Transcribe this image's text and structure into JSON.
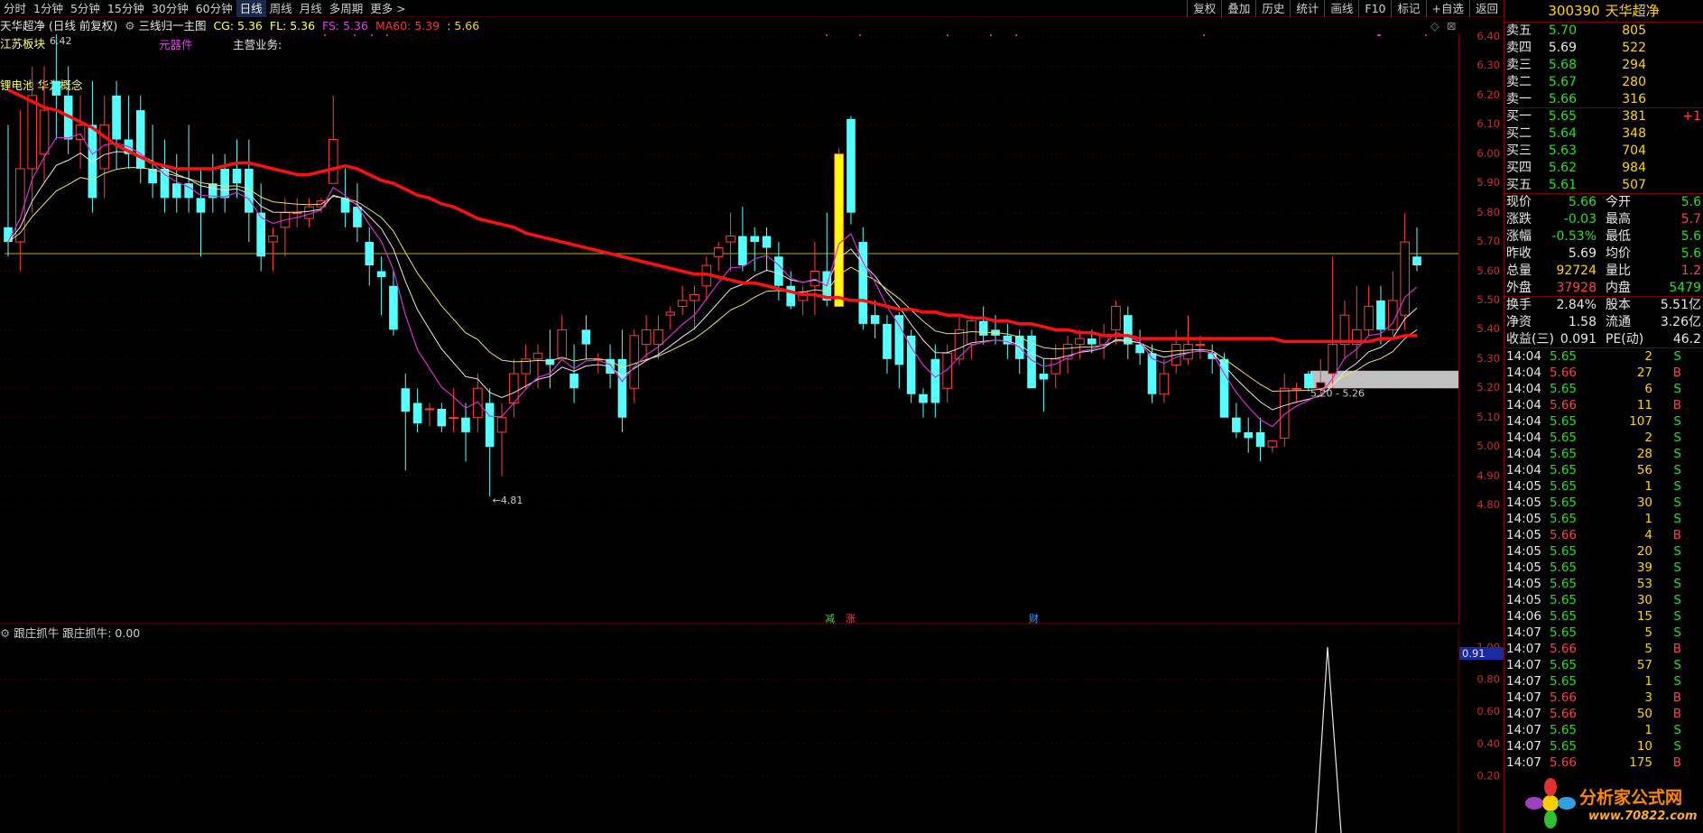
{
  "toolbar": {
    "periods": [
      "分时",
      "1分钟",
      "5分钟",
      "15分钟",
      "30分钟",
      "60分钟",
      "日线",
      "周线",
      "月线",
      "多周期",
      "更多 >"
    ],
    "active": "日线",
    "right": [
      "复权",
      "叠加",
      "历史",
      "统计",
      "画线",
      "F10",
      "标记",
      "+自选",
      "返回"
    ]
  },
  "info": {
    "stock_label": "天华超净",
    "mode": "(日线 前复权)",
    "indicator": "三线归一主图",
    "cg_label": "CG: 5.36",
    "fl_label": "FL: 5.36",
    "fs_label": "FS: 5.36",
    "ma60_label": "MA60: 5.39",
    "extra": ": 5.66",
    "sector": "江苏板块",
    "sector_price": "6.42",
    "component": "元器件",
    "business": "主营业务:",
    "concept": "锂电池 华为概念",
    "low_mark": "4.81",
    "range_mark": "5.20 - 5.26",
    "event_a": "减",
    "event_b": "涨",
    "event_c": "财"
  },
  "price_axis": [
    "6.40",
    "6.30",
    "6.20",
    "6.10",
    "6.00",
    "5.90",
    "5.80",
    "5.70",
    "5.60",
    "5.50",
    "5.40",
    "5.30",
    "5.20",
    "5.10",
    "5.00",
    "4.90",
    "4.80"
  ],
  "sub": {
    "title": "跟庄抓牛",
    "value_label": "跟庄抓牛: 0.00",
    "cursor_value": "0.91",
    "axis": [
      "1.00",
      "0.80",
      "0.60",
      "0.40",
      "0.20"
    ]
  },
  "chart_data": {
    "type": "candlestick",
    "ylim": [
      4.75,
      6.45
    ],
    "ohlc": [
      [
        5.75,
        6.1,
        5.65,
        5.7
      ],
      [
        5.7,
        6.15,
        5.6,
        5.95
      ],
      [
        5.95,
        6.3,
        5.8,
        6.2
      ],
      [
        6.0,
        6.3,
        5.9,
        6.15
      ],
      [
        6.25,
        6.42,
        6.05,
        6.2
      ],
      [
        6.2,
        6.3,
        6.0,
        6.05
      ],
      [
        6.05,
        6.2,
        5.95,
        6.1
      ],
      [
        6.1,
        6.25,
        5.8,
        5.85
      ],
      [
        5.95,
        6.2,
        5.85,
        6.1
      ],
      [
        6.2,
        6.25,
        5.95,
        6.05
      ],
      [
        6.05,
        6.2,
        5.95,
        6.0
      ],
      [
        6.15,
        6.2,
        5.9,
        5.95
      ],
      [
        5.95,
        6.1,
        5.85,
        5.9
      ],
      [
        5.95,
        6.05,
        5.8,
        5.85
      ],
      [
        5.9,
        6.0,
        5.8,
        5.85
      ],
      [
        5.9,
        6.1,
        5.8,
        5.85
      ],
      [
        5.85,
        5.95,
        5.65,
        5.8
      ],
      [
        5.9,
        6.0,
        5.8,
        5.85
      ],
      [
        5.95,
        6.0,
        5.8,
        5.85
      ],
      [
        5.95,
        6.05,
        5.85,
        5.9
      ],
      [
        5.95,
        6.05,
        5.7,
        5.8
      ],
      [
        5.8,
        5.9,
        5.6,
        5.65
      ],
      [
        5.7,
        5.75,
        5.6,
        5.72
      ],
      [
        5.75,
        5.85,
        5.65,
        5.8
      ],
      [
        5.8,
        5.85,
        5.75,
        5.8
      ],
      [
        5.78,
        5.85,
        5.75,
        5.82
      ],
      [
        5.82,
        5.85,
        5.8,
        5.84
      ],
      [
        5.9,
        6.2,
        5.9,
        6.05
      ],
      [
        5.85,
        5.95,
        5.75,
        5.8
      ],
      [
        5.82,
        5.9,
        5.7,
        5.75
      ],
      [
        5.7,
        5.75,
        5.55,
        5.62
      ],
      [
        5.6,
        5.65,
        5.45,
        5.58
      ],
      [
        5.55,
        5.6,
        5.38,
        5.4
      ],
      [
        5.2,
        5.25,
        4.92,
        5.12
      ],
      [
        5.15,
        5.2,
        5.05,
        5.08
      ],
      [
        5.13,
        5.15,
        5.07,
        5.13
      ],
      [
        5.13,
        5.15,
        5.05,
        5.07
      ],
      [
        5.1,
        5.2,
        5.05,
        5.1
      ],
      [
        5.1,
        5.15,
        4.95,
        5.05
      ],
      [
        5.1,
        5.25,
        5.05,
        5.2
      ],
      [
        5.15,
        5.2,
        4.83,
        5.0
      ],
      [
        5.05,
        5.15,
        4.9,
        5.1
      ],
      [
        5.15,
        5.3,
        5.1,
        5.25
      ],
      [
        5.25,
        5.35,
        5.2,
        5.3
      ],
      [
        5.3,
        5.35,
        5.2,
        5.32
      ],
      [
        5.3,
        5.4,
        5.2,
        5.28
      ],
      [
        5.3,
        5.45,
        5.3,
        5.4
      ],
      [
        5.25,
        5.35,
        5.15,
        5.2
      ],
      [
        5.4,
        5.45,
        5.3,
        5.35
      ],
      [
        5.3,
        5.32,
        5.25,
        5.3
      ],
      [
        5.3,
        5.35,
        5.2,
        5.25
      ],
      [
        5.3,
        5.4,
        5.05,
        5.1
      ],
      [
        5.2,
        5.4,
        5.15,
        5.38
      ],
      [
        5.35,
        5.45,
        5.3,
        5.4
      ],
      [
        5.35,
        5.45,
        5.3,
        5.4
      ],
      [
        5.45,
        5.48,
        5.4,
        5.46
      ],
      [
        5.48,
        5.55,
        5.45,
        5.5
      ],
      [
        5.5,
        5.55,
        5.4,
        5.52
      ],
      [
        5.55,
        5.65,
        5.5,
        5.62
      ],
      [
        5.65,
        5.7,
        5.6,
        5.68
      ],
      [
        5.7,
        5.8,
        5.6,
        5.72
      ],
      [
        5.72,
        5.82,
        5.6,
        5.62
      ],
      [
        5.72,
        5.75,
        5.6,
        5.7
      ],
      [
        5.72,
        5.75,
        5.6,
        5.68
      ],
      [
        5.65,
        5.7,
        5.5,
        5.55
      ],
      [
        5.55,
        5.6,
        5.47,
        5.48
      ],
      [
        5.5,
        5.55,
        5.45,
        5.53
      ],
      [
        5.55,
        5.7,
        5.45,
        5.6
      ],
      [
        5.6,
        5.8,
        5.48,
        5.5
      ],
      [
        5.48,
        6.02,
        5.48,
        6.0
      ],
      [
        6.12,
        6.13,
        5.76,
        5.8
      ],
      [
        5.7,
        5.75,
        5.4,
        5.42
      ],
      [
        5.45,
        5.5,
        5.37,
        5.42
      ],
      [
        5.42,
        5.45,
        5.25,
        5.3
      ],
      [
        5.45,
        5.46,
        5.2,
        5.28
      ],
      [
        5.38,
        5.4,
        5.15,
        5.18
      ],
      [
        5.18,
        5.2,
        5.1,
        5.15
      ],
      [
        5.3,
        5.35,
        5.1,
        5.15
      ],
      [
        5.2,
        5.35,
        5.15,
        5.32
      ],
      [
        5.3,
        5.45,
        5.28,
        5.4
      ],
      [
        5.35,
        5.45,
        5.3,
        5.43
      ],
      [
        5.43,
        5.48,
        5.35,
        5.38
      ],
      [
        5.4,
        5.45,
        5.35,
        5.38
      ],
      [
        5.38,
        5.42,
        5.3,
        5.35
      ],
      [
        5.38,
        5.4,
        5.25,
        5.3
      ],
      [
        5.38,
        5.4,
        5.2,
        5.2
      ],
      [
        5.25,
        5.3,
        5.12,
        5.23
      ],
      [
        5.25,
        5.35,
        5.2,
        5.3
      ],
      [
        5.3,
        5.38,
        5.25,
        5.35
      ],
      [
        5.35,
        5.4,
        5.3,
        5.37
      ],
      [
        5.37,
        5.4,
        5.32,
        5.35
      ],
      [
        5.35,
        5.42,
        5.3,
        5.38
      ],
      [
        5.4,
        5.5,
        5.35,
        5.48
      ],
      [
        5.45,
        5.48,
        5.3,
        5.35
      ],
      [
        5.35,
        5.4,
        5.28,
        5.32
      ],
      [
        5.32,
        5.35,
        5.15,
        5.18
      ],
      [
        5.18,
        5.3,
        5.15,
        5.25
      ],
      [
        5.28,
        5.4,
        5.25,
        5.35
      ],
      [
        5.3,
        5.45,
        5.28,
        5.35
      ],
      [
        5.35,
        5.38,
        5.3,
        5.35
      ],
      [
        5.32,
        5.35,
        5.25,
        5.3
      ],
      [
        5.3,
        5.32,
        5.1,
        5.1
      ],
      [
        5.1,
        5.15,
        5.03,
        5.05
      ],
      [
        5.05,
        5.1,
        4.98,
        5.03
      ],
      [
        5.05,
        5.1,
        4.95,
        5.0
      ],
      [
        5.0,
        5.02,
        4.98,
        5.02
      ],
      [
        5.03,
        5.25,
        5.0,
        5.2
      ],
      [
        5.2,
        5.22,
        5.15,
        5.2
      ],
      [
        5.25,
        5.26,
        5.19,
        5.2
      ],
      [
        5.2,
        5.3,
        5.18,
        5.22
      ],
      [
        5.25,
        5.65,
        5.2,
        5.35
      ],
      [
        5.35,
        5.5,
        5.3,
        5.45
      ],
      [
        5.35,
        5.55,
        5.3,
        5.4
      ],
      [
        5.4,
        5.55,
        5.38,
        5.48
      ],
      [
        5.5,
        5.55,
        5.35,
        5.4
      ],
      [
        5.4,
        5.6,
        5.38,
        5.5
      ],
      [
        5.45,
        5.8,
        5.4,
        5.7
      ],
      [
        5.65,
        5.75,
        5.6,
        5.62
      ]
    ],
    "ma60": [
      6.22,
      6.2,
      6.18,
      6.16,
      6.15,
      6.13,
      6.11,
      6.09,
      6.06,
      6.03,
      6.01,
      5.99,
      5.97,
      5.96,
      5.95,
      5.95,
      5.95,
      5.95,
      5.96,
      5.97,
      5.97,
      5.96,
      5.95,
      5.94,
      5.93,
      5.93,
      5.94,
      5.95,
      5.96,
      5.95,
      5.93,
      5.91,
      5.9,
      5.88,
      5.86,
      5.85,
      5.83,
      5.82,
      5.8,
      5.78,
      5.77,
      5.76,
      5.75,
      5.73,
      5.72,
      5.71,
      5.7,
      5.69,
      5.68,
      5.67,
      5.66,
      5.65,
      5.64,
      5.63,
      5.62,
      5.61,
      5.6,
      5.59,
      5.59,
      5.58,
      5.57,
      5.56,
      5.56,
      5.55,
      5.54,
      5.53,
      5.52,
      5.52,
      5.51,
      5.51,
      5.5,
      5.5,
      5.49,
      5.48,
      5.47,
      5.47,
      5.46,
      5.46,
      5.45,
      5.45,
      5.44,
      5.44,
      5.43,
      5.43,
      5.42,
      5.42,
      5.41,
      5.4,
      5.4,
      5.39,
      5.39,
      5.38,
      5.38,
      5.38,
      5.37,
      5.37,
      5.37,
      5.37,
      5.37,
      5.37,
      5.37,
      5.37,
      5.37,
      5.37,
      5.37,
      5.37,
      5.36,
      5.36,
      5.36,
      5.36,
      5.36,
      5.36,
      5.36,
      5.36,
      5.37,
      5.37,
      5.38,
      5.38
    ],
    "kline_colors": {
      "up": "#ff3c3c",
      "down": "#54ffff",
      "ma60": "#ff1010",
      "cg": "#e8e8e8",
      "fl": "#e8e070",
      "fs": "#d030d0"
    }
  },
  "quote": {
    "code": "300390",
    "name": "天华超净",
    "asks": [
      {
        "label": "卖五",
        "price": "5.70",
        "vol": "805"
      },
      {
        "label": "卖四",
        "price": "5.69",
        "vol": "522"
      },
      {
        "label": "卖三",
        "price": "5.68",
        "vol": "294"
      },
      {
        "label": "卖二",
        "price": "5.67",
        "vol": "280"
      },
      {
        "label": "卖一",
        "price": "5.66",
        "vol": "316"
      }
    ],
    "bids": [
      {
        "label": "买一",
        "price": "5.65",
        "vol": "381",
        "extra": "+1"
      },
      {
        "label": "买二",
        "price": "5.64",
        "vol": "348"
      },
      {
        "label": "买三",
        "price": "5.63",
        "vol": "704"
      },
      {
        "label": "买四",
        "price": "5.62",
        "vol": "984"
      },
      {
        "label": "买五",
        "price": "5.61",
        "vol": "507"
      }
    ],
    "stats": [
      {
        "l1": "现价",
        "v1": "5.66",
        "c1": "g",
        "l2": "今开",
        "v2": "5.6",
        "c2": "g"
      },
      {
        "l1": "涨跌",
        "v1": "-0.03",
        "c1": "g",
        "l2": "最高",
        "v2": "5.7",
        "c2": "r"
      },
      {
        "l1": "涨幅",
        "v1": "-0.53%",
        "c1": "g",
        "l2": "最低",
        "v2": "5.6",
        "c2": "g"
      },
      {
        "l1": "昨收",
        "v1": "5.69",
        "c1": "w",
        "l2": "均价",
        "v2": "5.6",
        "c2": "g"
      },
      {
        "l1": "总量",
        "v1": "92724",
        "c1": "y",
        "l2": "量比",
        "v2": "1.2",
        "c2": "r"
      },
      {
        "l1": "外盘",
        "v1": "37928",
        "c1": "r",
        "l2": "内盘",
        "v2": "5479",
        "c2": "g"
      },
      {
        "l1": "换手",
        "v1": "2.84%",
        "c1": "w",
        "l2": "股本",
        "v2": "5.51亿",
        "c2": "w"
      },
      {
        "l1": "净资",
        "v1": "1.58",
        "c1": "w",
        "l2": "流通",
        "v2": "3.26亿",
        "c2": "w"
      },
      {
        "l1": "收益(三)",
        "v1": "0.091",
        "c1": "w",
        "l2": "PE(动)",
        "v2": "46.2",
        "c2": "w"
      }
    ],
    "ticks": [
      {
        "t": "14:04",
        "p": "5.65",
        "v": "2",
        "s": "S"
      },
      {
        "t": "14:04",
        "p": "5.66",
        "v": "27",
        "s": "B"
      },
      {
        "t": "14:04",
        "p": "5.65",
        "v": "6",
        "s": "S"
      },
      {
        "t": "14:04",
        "p": "5.66",
        "v": "11",
        "s": "B"
      },
      {
        "t": "14:04",
        "p": "5.65",
        "v": "107",
        "s": "S"
      },
      {
        "t": "14:04",
        "p": "5.65",
        "v": "2",
        "s": "S"
      },
      {
        "t": "14:04",
        "p": "5.65",
        "v": "28",
        "s": "S"
      },
      {
        "t": "14:04",
        "p": "5.65",
        "v": "56",
        "s": "S"
      },
      {
        "t": "14:05",
        "p": "5.65",
        "v": "1",
        "s": "S"
      },
      {
        "t": "14:05",
        "p": "5.65",
        "v": "30",
        "s": "S"
      },
      {
        "t": "14:05",
        "p": "5.65",
        "v": "1",
        "s": "S"
      },
      {
        "t": "14:05",
        "p": "5.66",
        "v": "4",
        "s": "B"
      },
      {
        "t": "14:05",
        "p": "5.65",
        "v": "20",
        "s": "S"
      },
      {
        "t": "14:05",
        "p": "5.65",
        "v": "39",
        "s": "S"
      },
      {
        "t": "14:05",
        "p": "5.65",
        "v": "53",
        "s": "S"
      },
      {
        "t": "14:05",
        "p": "5.65",
        "v": "30",
        "s": "S"
      },
      {
        "t": "14:06",
        "p": "5.65",
        "v": "15",
        "s": "S"
      },
      {
        "t": "14:07",
        "p": "5.65",
        "v": "5",
        "s": "S"
      },
      {
        "t": "14:07",
        "p": "5.66",
        "v": "5",
        "s": "B"
      },
      {
        "t": "14:07",
        "p": "5.65",
        "v": "57",
        "s": "S"
      },
      {
        "t": "14:07",
        "p": "5.65",
        "v": "1",
        "s": "S"
      },
      {
        "t": "14:07",
        "p": "5.66",
        "v": "3",
        "s": "B"
      },
      {
        "t": "14:07",
        "p": "5.66",
        "v": "50",
        "s": "B"
      },
      {
        "t": "14:07",
        "p": "5.65",
        "v": "1",
        "s": "S"
      },
      {
        "t": "14:07",
        "p": "5.65",
        "v": "10",
        "s": "S"
      },
      {
        "t": "14:07",
        "p": "5.66",
        "v": "175",
        "s": "B"
      }
    ]
  },
  "watermark": {
    "title": "分析家公式网",
    "url": "www.70822.com"
  }
}
